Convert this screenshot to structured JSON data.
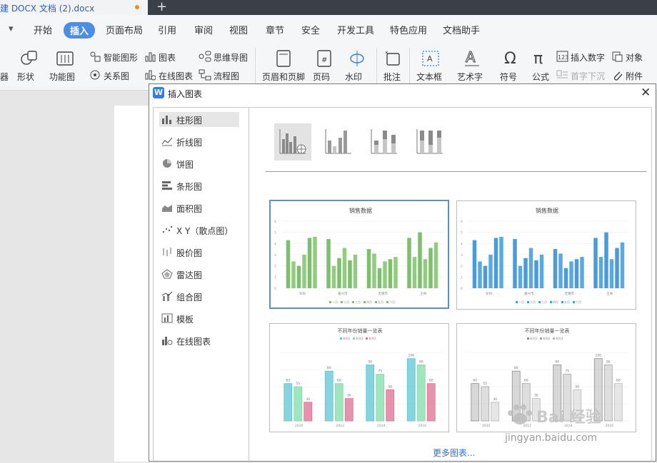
{
  "tabbar": {
    "doc_tab_label": "建 DOCX 文档 (2).docx",
    "new_tab": "+"
  },
  "menubar": {
    "items": [
      "开始",
      "插入",
      "页面布局",
      "引用",
      "审阅",
      "视图",
      "章节",
      "安全",
      "开发工具",
      "特色应用",
      "文档助手"
    ],
    "active": "插入",
    "dropdown": "▾"
  },
  "ribbon": {
    "shape": "形状",
    "function_chart": "功能图",
    "smart_graphic": "智能图形",
    "relation_chart": "关系图",
    "chart": "图表",
    "online_chart": "在线图表",
    "mind_map": "思维导图",
    "flowchart": "流程图",
    "header_footer": "页眉和页脚",
    "page_number": "页码",
    "watermark": "水印",
    "comment": "批注",
    "textbox": "文本框",
    "art_text": "艺术字",
    "symbol": "符号",
    "formula": "公式",
    "insert_number": "插入数字",
    "object": "对象",
    "drop_cap": "首字下沉",
    "attachment": "附件",
    "cut_label": "器"
  },
  "dialog": {
    "title": "插入图表",
    "logo": "W",
    "close": "✕",
    "chart_types": [
      "柱形图",
      "折线图",
      "饼图",
      "条形图",
      "面积图",
      "X Y（散点图）",
      "股价图",
      "雷达图",
      "组合图",
      "模板",
      "在线图表"
    ],
    "selected_type": "柱形图",
    "more_charts": "更多图表...",
    "templates": [
      {
        "title": "销售数据",
        "colors": [
          "#7dbf6c",
          "#92cc80"
        ],
        "categories": [
          "深圳",
          "嘉兴市",
          "无锡市",
          "王林"
        ],
        "legend": [
          "一月",
          "二月",
          "三月",
          "四月",
          "五月",
          "六月"
        ],
        "yticks": [
          "6",
          "5",
          "4",
          "3",
          "2",
          "1",
          "0"
        ]
      },
      {
        "title": "销售数据",
        "colors": [
          "#4a9bd8",
          "#5aa9e0"
        ],
        "categories": [
          "深圳",
          "嘉兴市",
          "无锡市",
          "王林"
        ],
        "legend": [
          "一月",
          "二月",
          "三月",
          "四月",
          "五月",
          "六月"
        ],
        "yticks": [
          "6",
          "5",
          "4",
          "3",
          "2",
          "1",
          "0"
        ]
      },
      {
        "title": "不同年份销量一览表",
        "colors": [
          "#5cc6d6",
          "#7fdca8",
          "#e06f93"
        ],
        "categories": [
          "2010",
          "2012",
          "2014",
          "2016"
        ],
        "legend": [
          "系列1",
          "系列2",
          "系列3"
        ],
        "values": [
          [
            60,
            55,
            30
          ],
          [
            80,
            60,
            36
          ],
          [
            90,
            75,
            50
          ],
          [
            100,
            90,
            60
          ]
        ]
      },
      {
        "title": "不同年份销量一览表",
        "colors": [
          "#8d8d8d",
          "#a0a0a0",
          "#b8b8b8"
        ],
        "categories": [
          "2010",
          "2012",
          "2014",
          "2016"
        ],
        "legend": [
          "系列1",
          "系列2",
          "系列3"
        ],
        "values": [
          [
            60,
            55,
            30
          ],
          [
            80,
            60,
            36
          ],
          [
            90,
            75,
            50
          ],
          [
            100,
            90,
            60
          ]
        ]
      }
    ],
    "sales_values": [
      [
        4.3,
        2.4,
        2.0,
        3.0,
        4.5,
        4.6
      ],
      [
        4.4,
        2.0,
        2.7,
        3.6,
        2.5,
        3.0
      ],
      [
        3.5,
        3.1,
        1.8,
        2.4,
        2.6,
        2.8
      ],
      [
        4.5,
        2.8,
        5.0,
        2.6,
        3.6,
        4.1
      ]
    ]
  },
  "watermark": {
    "text": "Bai 经验",
    "url": "jingyan.baidu.com"
  }
}
